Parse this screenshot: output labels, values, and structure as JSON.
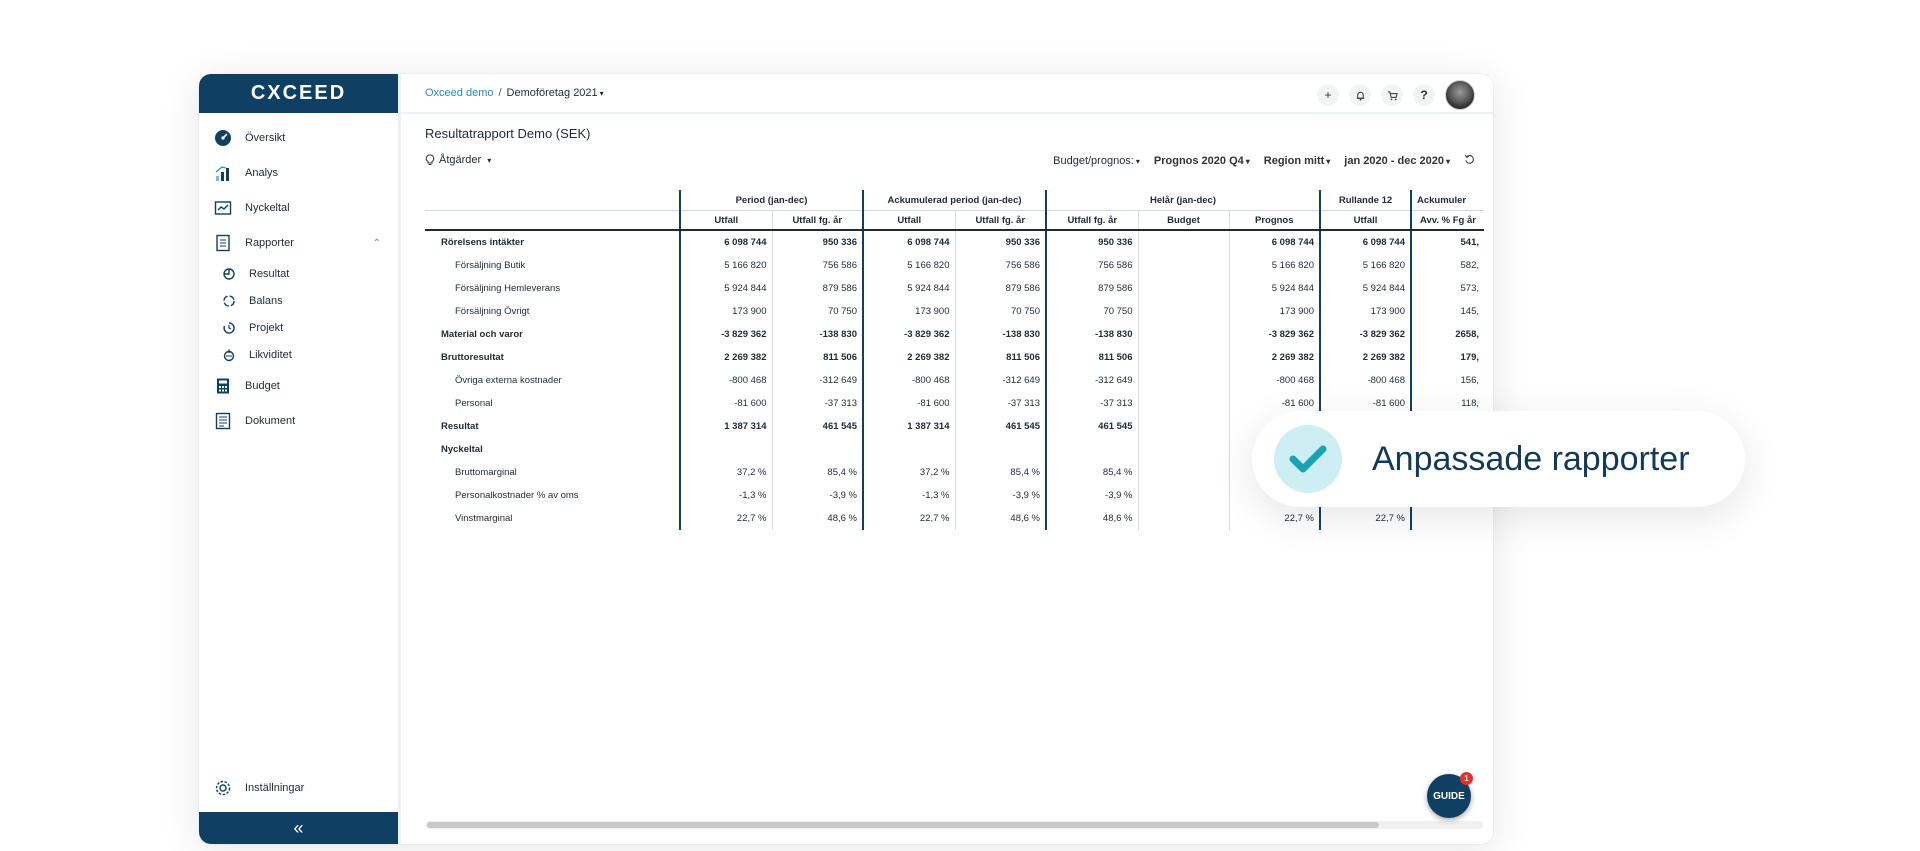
{
  "brand": {
    "logo_text": "CXCEED"
  },
  "sidebar": {
    "items": [
      {
        "label": "Översikt",
        "icon": "dashboard-icon"
      },
      {
        "label": "Analys",
        "icon": "bar-chart-icon"
      },
      {
        "label": "Nyckeltal",
        "icon": "kpi-icon"
      },
      {
        "label": "Rapporter",
        "icon": "report-icon",
        "expanded": true
      },
      {
        "label": "Budget",
        "icon": "calculator-icon"
      },
      {
        "label": "Dokument",
        "icon": "document-icon"
      }
    ],
    "sub_items": [
      {
        "label": "Resultat",
        "icon": "result-icon"
      },
      {
        "label": "Balans",
        "icon": "balance-icon"
      },
      {
        "label": "Projekt",
        "icon": "project-icon"
      },
      {
        "label": "Likviditet",
        "icon": "liquidity-icon"
      }
    ],
    "settings_label": "Inställningar",
    "collapse_glyph": "«"
  },
  "breadcrumb": {
    "root": "Oxceed demo",
    "separator": "/",
    "current": "Demoföretag 2021"
  },
  "top_icons": {
    "add": "+",
    "help": "?"
  },
  "report": {
    "title": "Resultatrapport Demo (SEK)",
    "actions_label": "Åtgärder",
    "filters": {
      "budget_label": "Budget/prognos:",
      "forecast": "Prognos 2020 Q4",
      "region": "Region mitt",
      "period": "jan 2020 - dec 2020"
    },
    "group_headers": [
      "Period (jan-dec)",
      "Ackumulerad period (jan-dec)",
      "Helår (jan-dec)",
      "Rullande 12",
      "Ackumuler"
    ],
    "column_headers": [
      "Utfall",
      "Utfall fg. år",
      "Utfall",
      "Utfall fg. år",
      "Utfall fg. år",
      "Budget",
      "Prognos",
      "Utfall",
      "Avv. % Fg år"
    ],
    "rows": [
      {
        "label": "Rörelsens intäkter",
        "bold": true,
        "indent": 1,
        "values": [
          "6 098 744",
          "950 336",
          "6 098 744",
          "950 336",
          "950 336",
          "",
          "6 098 744",
          "6 098 744",
          "541,"
        ]
      },
      {
        "label": "Försäljning Butik",
        "bold": false,
        "indent": 2,
        "values": [
          "5 166 820",
          "756 586",
          "5 166 820",
          "756 586",
          "756 586",
          "",
          "5 166 820",
          "5 166 820",
          "582,"
        ]
      },
      {
        "label": "Försäljning Hemleverans",
        "bold": false,
        "indent": 2,
        "values": [
          "5 924 844",
          "879 586",
          "5 924 844",
          "879 586",
          "879 586",
          "",
          "5 924 844",
          "5 924 844",
          "573,"
        ]
      },
      {
        "label": "Försäljning Övrigt",
        "bold": false,
        "indent": 2,
        "values": [
          "173 900",
          "70 750",
          "173 900",
          "70 750",
          "70 750",
          "",
          "173 900",
          "173 900",
          "145,"
        ]
      },
      {
        "label": "Material och varor",
        "bold": true,
        "indent": 1,
        "values": [
          "-3 829 362",
          "-138 830",
          "-3 829 362",
          "-138 830",
          "-138 830",
          "",
          "-3 829 362",
          "-3 829 362",
          "2658,"
        ]
      },
      {
        "label": "Bruttoresultat",
        "bold": true,
        "indent": 1,
        "values": [
          "2 269 382",
          "811 506",
          "2 269 382",
          "811 506",
          "811 506",
          "",
          "2 269 382",
          "2 269 382",
          "179,"
        ]
      },
      {
        "label": "Övriga externa kostnader",
        "bold": false,
        "indent": 2,
        "values": [
          "-800 468",
          "-312 649",
          "-800 468",
          "-312 649",
          "-312 649",
          "",
          "-800 468",
          "-800 468",
          "156,"
        ]
      },
      {
        "label": "Personal",
        "bold": false,
        "indent": 2,
        "values": [
          "-81 600",
          "-37 313",
          "-81 600",
          "-37 313",
          "-37 313",
          "",
          "-81 600",
          "-81 600",
          "118,"
        ]
      },
      {
        "label": "Resultat",
        "bold": true,
        "indent": 1,
        "values": [
          "1 387 314",
          "461 545",
          "1 387 314",
          "461 545",
          "461 545",
          "",
          "",
          "",
          ""
        ]
      },
      {
        "label": "Nyckeltal",
        "bold": true,
        "indent": 1,
        "values": [
          "",
          "",
          "",
          "",
          "",
          "",
          "",
          "",
          ""
        ]
      },
      {
        "label": "Bruttomarginal",
        "bold": false,
        "indent": 2,
        "values": [
          "37,2 %",
          "85,4 %",
          "37,2 %",
          "85,4 %",
          "85,4 %",
          "",
          "",
          "",
          ""
        ]
      },
      {
        "label": "Personalkostnader % av oms",
        "bold": false,
        "indent": 2,
        "values": [
          "-1,3 %",
          "-3,9 %",
          "-1,3 %",
          "-3,9 %",
          "-3,9 %",
          "",
          "",
          "",
          ""
        ]
      },
      {
        "label": "Vinstmarginal",
        "bold": false,
        "indent": 2,
        "values": [
          "22,7 %",
          "48,6 %",
          "22,7 %",
          "48,6 %",
          "48,6 %",
          "",
          "22,7 %",
          "22,7 %",
          ""
        ]
      }
    ]
  },
  "guide": {
    "label": "GUIDE",
    "badge": "1"
  },
  "callout": {
    "text": "Anpassade rapporter",
    "accent": "#1aa3b5",
    "bg": "#cdeef3"
  },
  "colors": {
    "brand": "#0f4064",
    "link": "#1f8fbe"
  }
}
